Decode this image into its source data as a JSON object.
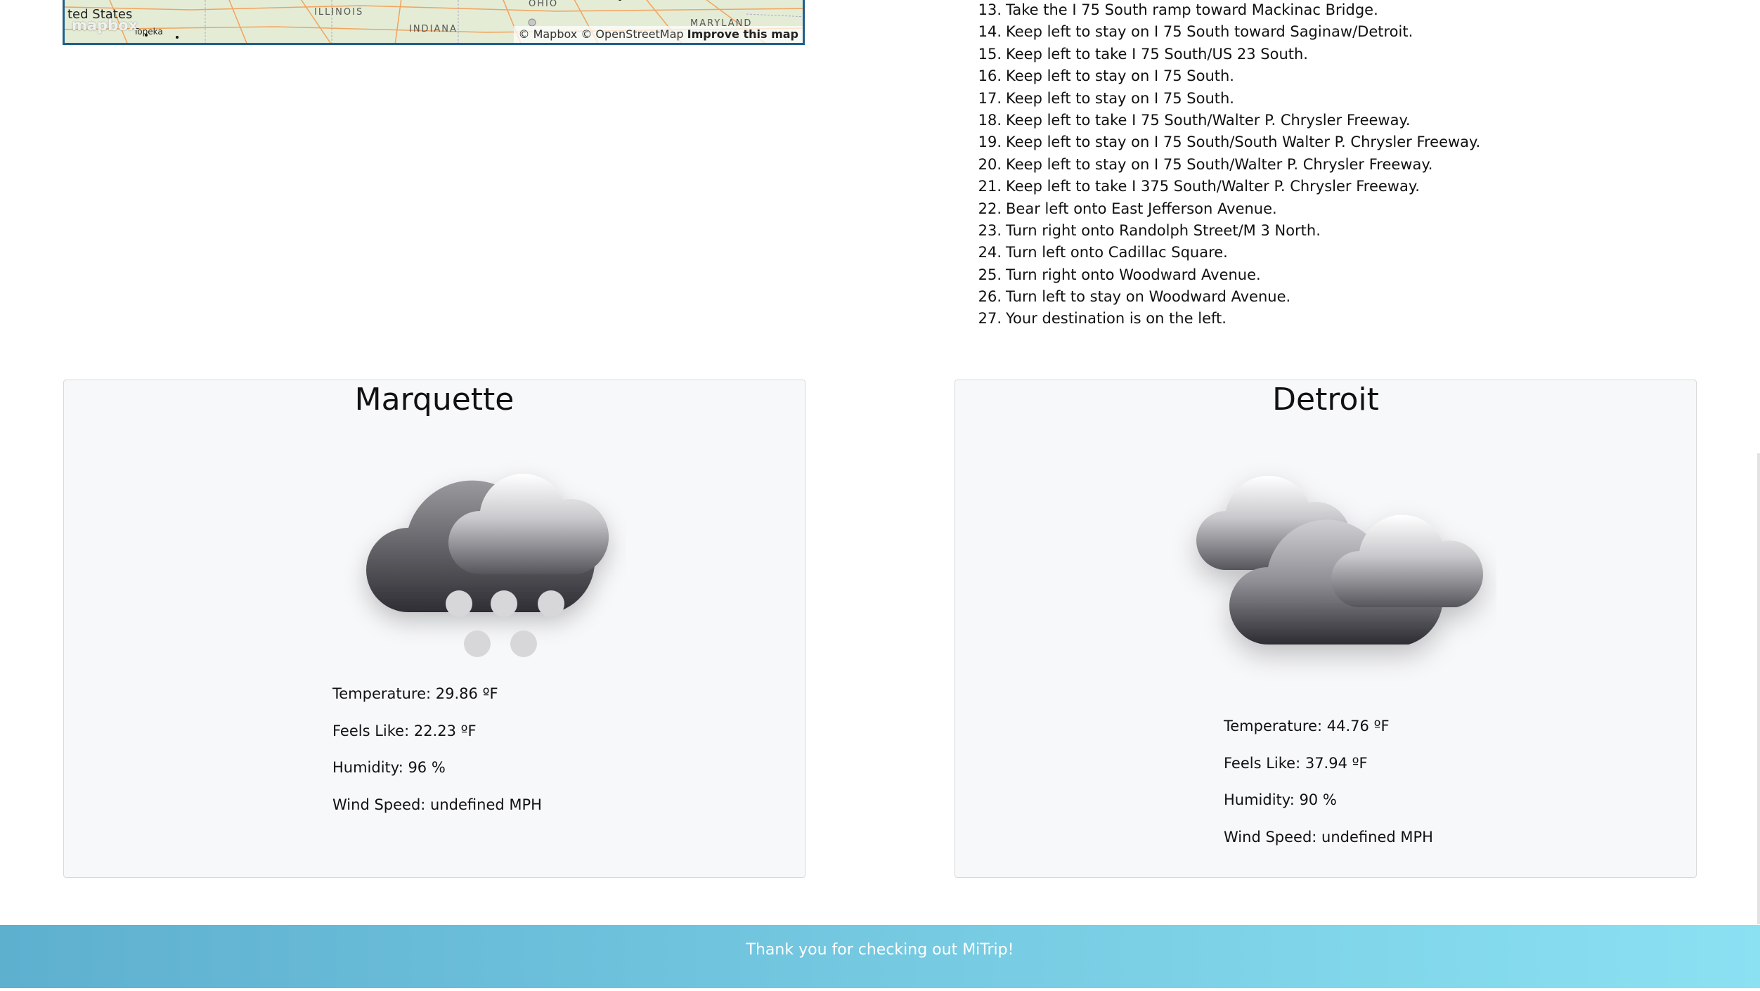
{
  "map": {
    "country_label": "ted States",
    "town_label": "Topeka",
    "state_labels": [
      "ILLINOIS",
      "INDIANA",
      "OHIO",
      "MARYLAND"
    ],
    "logo": "mapbox",
    "attribution": "© Mapbox © OpenStreetMap",
    "improve_link": "Improve this map"
  },
  "directions": [
    {
      "num": "13.",
      "text": "Take the I 75 South ramp toward Mackinac Bridge."
    },
    {
      "num": "14.",
      "text": "Keep left to stay on I 75 South toward Saginaw/Detroit."
    },
    {
      "num": "15.",
      "text": "Keep left to take I 75 South/US 23 South."
    },
    {
      "num": "16.",
      "text": "Keep left to stay on I 75 South."
    },
    {
      "num": "17.",
      "text": "Keep left to stay on I 75 South."
    },
    {
      "num": "18.",
      "text": "Keep left to take I 75 South/Walter P. Chrysler Freeway."
    },
    {
      "num": "19.",
      "text": "Keep left to stay on I 75 South/South Walter P. Chrysler Freeway."
    },
    {
      "num": "20.",
      "text": "Keep left to stay on I 75 South/Walter P. Chrysler Freeway."
    },
    {
      "num": "21.",
      "text": "Keep left to take I 375 South/Walter P. Chrysler Freeway."
    },
    {
      "num": "22.",
      "text": "Bear left onto East Jefferson Avenue."
    },
    {
      "num": "23.",
      "text": "Turn right onto Randolph Street/M 3 North."
    },
    {
      "num": "24.",
      "text": "Turn left onto Cadillac Square."
    },
    {
      "num": "25.",
      "text": "Turn right onto Woodward Avenue."
    },
    {
      "num": "26.",
      "text": "Turn left to stay on Woodward Avenue."
    },
    {
      "num": "27.",
      "text": "Your destination is on the left."
    }
  ],
  "weather": {
    "origin": {
      "city": "Marquette",
      "icon": "snow-cloud-icon",
      "temperature": "Temperature: 29.86 ºF",
      "feels_like": "Feels Like: 22.23 ºF",
      "humidity": "Humidity: 96 %",
      "wind": "Wind Speed: undefined MPH"
    },
    "destination": {
      "city": "Detroit",
      "icon": "cloudy-icon",
      "temperature": "Temperature: 44.76 ºF",
      "feels_like": "Feels Like: 37.94 ºF",
      "humidity": "Humidity: 90 %",
      "wind": "Wind Speed: undefined MPH"
    }
  },
  "footer": {
    "text": "Thank you for checking out MiTrip!"
  },
  "colors": {
    "map_border": "#1f5f8f",
    "card_bg": "#f7f8fa",
    "footer_gradient_start": "#5eb0cf",
    "footer_gradient_end": "#8be1f2"
  }
}
